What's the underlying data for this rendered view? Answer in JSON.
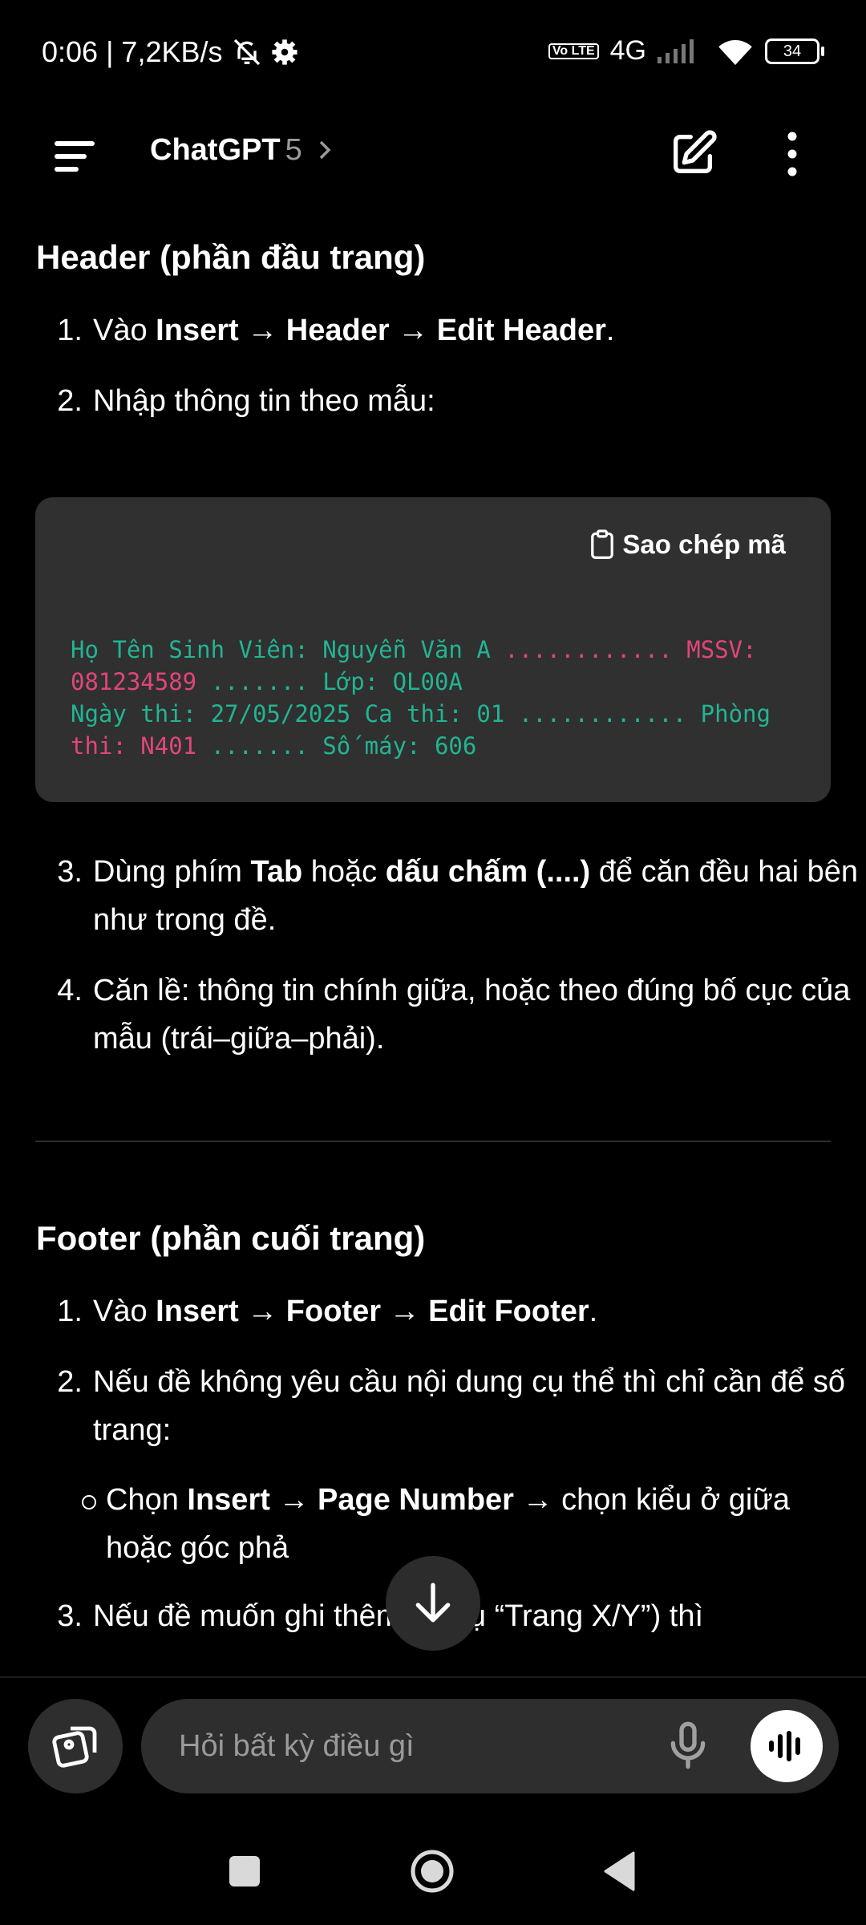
{
  "status_bar": {
    "time": "0:06",
    "net_speed": "| 7,2KB/s",
    "network": "4G",
    "volte": "Vo LTE",
    "battery": "34"
  },
  "top_bar": {
    "title": "ChatGPT",
    "version": "5"
  },
  "content": {
    "header_section": {
      "title": "Header (phần đầu trang)",
      "step1": {
        "num": "1.",
        "pre": "Vào ",
        "b1": "Insert",
        "arrow1": " → ",
        "b2": "Header",
        "arrow2": " → ",
        "b3": "Edit Header",
        "post": "."
      },
      "step2": {
        "num": "2.",
        "text": "Nhập thông tin theo mẫu:"
      },
      "code_block": {
        "copy_label": "Sao chép mã",
        "line1_a": "Họ Tên Sinh Viên: Nguyễn Văn A",
        "line1_b": " ............ MSSV:",
        "line2_a": "081234589",
        "line2_b": " ....... Lớp: QL00A",
        "line3_a": "Ngày thi: 27/05/2025 Ca thi: 01",
        "line3_b": " ............ Phòng",
        "line4_a": "thi: N401",
        "line4_b": " ....... Số máy: 606"
      },
      "step3": {
        "num": "3.",
        "pre": "Dùng phím ",
        "b1": "Tab",
        "mid": " hoặc ",
        "b2": "dấu chấm (....)",
        "post": " để căn đều hai bên như trong đề."
      },
      "step4": {
        "num": "4.",
        "text": "Căn lề: thông tin chính giữa, hoặc theo đúng bố cục của mẫu (trái–giữa–phải)."
      }
    },
    "footer_section": {
      "title": "Footer (phần cuối trang)",
      "step1": {
        "num": "1.",
        "pre": "Vào ",
        "b1": "Insert",
        "arrow1": " → ",
        "b2": "Footer",
        "arrow2": " → ",
        "b3": "Edit Footer",
        "post": "."
      },
      "step2": {
        "num": "2.",
        "text": "Nếu đề không yêu cầu nội dung cụ thể thì chỉ cần để số trang:"
      },
      "sub_bullet": {
        "pre": "Chọn ",
        "b1": "Insert",
        "arrow": " → ",
        "b2": "Page Number",
        "post": " → chọn kiểu ở giữa hoặc góc phả"
      },
      "step3": {
        "num": "3.",
        "text": "Nếu đề muốn ghi thêm (ví dụ “Trang X/Y”) thì"
      }
    }
  },
  "composer": {
    "placeholder": "Hỏi bất kỳ điều gì"
  }
}
